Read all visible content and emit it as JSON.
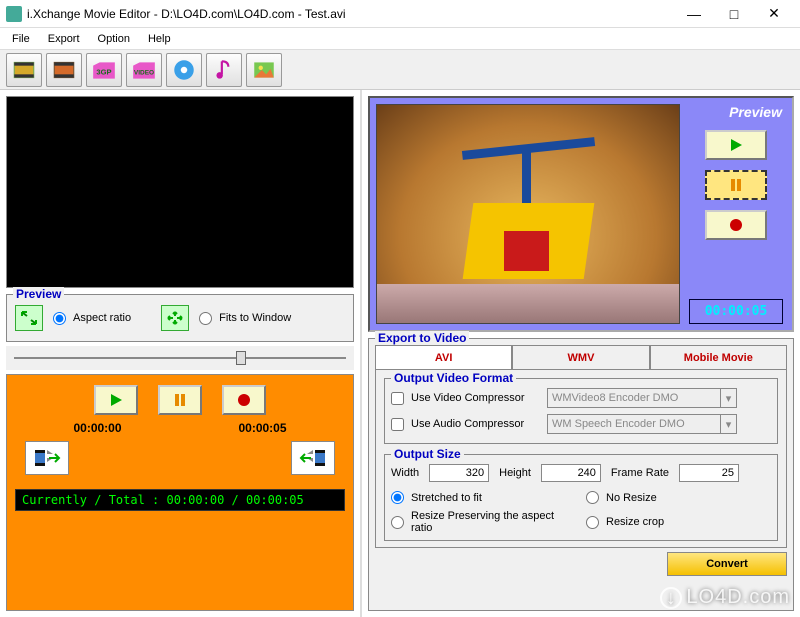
{
  "window": {
    "title": "i.Xchange Movie Editor - D:\\LO4D.com\\LO4D.com - Test.avi"
  },
  "menu": {
    "file": "File",
    "export": "Export",
    "option": "Option",
    "help": "Help"
  },
  "left": {
    "preview_legend": "Preview",
    "aspect_ratio": "Aspect ratio",
    "fits_to_window": "Fits to Window",
    "time_start": "00:00:00",
    "time_end": "00:00:05",
    "status": "Currently / Total : 00:00:00 / 00:00:05"
  },
  "right": {
    "preview_label": "Preview",
    "timer": "00:00:05",
    "export_legend": "Export to Video",
    "tabs": {
      "avi": "AVI",
      "wmv": "WMV",
      "mobile": "Mobile Movie"
    },
    "ovf_legend": "Output Video Format",
    "use_video": "Use Video Compressor",
    "use_audio": "Use Audio Compressor",
    "video_enc": "WMVideo8 Encoder DMO",
    "audio_enc": "WM Speech Encoder DMO",
    "osize_legend": "Output Size",
    "width_lbl": "Width",
    "width_val": "320",
    "height_lbl": "Height",
    "height_val": "240",
    "fr_lbl": "Frame Rate",
    "fr_val": "25",
    "opt_stretch": "Stretched to fit",
    "opt_noresize": "No Resize",
    "opt_preserve": "Resize Preserving the aspect ratio",
    "opt_crop": "Resize crop",
    "convert": "Convert"
  },
  "watermark": "LO4D.com"
}
